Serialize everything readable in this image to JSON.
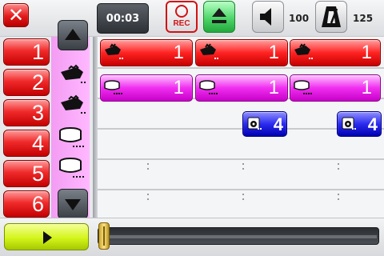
{
  "toolbar": {
    "close_label": "✕",
    "timer": "00:03",
    "rec_label": "REC",
    "volume_value": "100",
    "tempo_value": "125"
  },
  "tracks": [
    {
      "label": "1"
    },
    {
      "label": "2"
    },
    {
      "label": "3"
    },
    {
      "label": "4"
    },
    {
      "label": "5"
    },
    {
      "label": "6"
    }
  ],
  "instruments": [
    {
      "icon": "hand-clap-icon"
    },
    {
      "icon": "hand-clap-icon"
    },
    {
      "icon": "drum-icon"
    },
    {
      "icon": "drum-icon"
    }
  ],
  "clips": {
    "row1": [
      {
        "label": "1"
      },
      {
        "label": "1"
      },
      {
        "label": "1"
      }
    ],
    "row2": [
      {
        "label": "1"
      },
      {
        "label": "1"
      },
      {
        "label": "1"
      }
    ],
    "row3": [
      {
        "label": "4"
      },
      {
        "label": "4"
      }
    ]
  },
  "playback": {
    "position_fraction": 0
  },
  "colors": {
    "track": "#e81818",
    "instrument_column": "#f9a8f9",
    "clip_red": "#f02020",
    "clip_pink": "#f02ef0",
    "clip_blue": "#2b2bf0",
    "play": "#d4f51a",
    "rec": "#d21313",
    "eject": "#4fd56a"
  }
}
